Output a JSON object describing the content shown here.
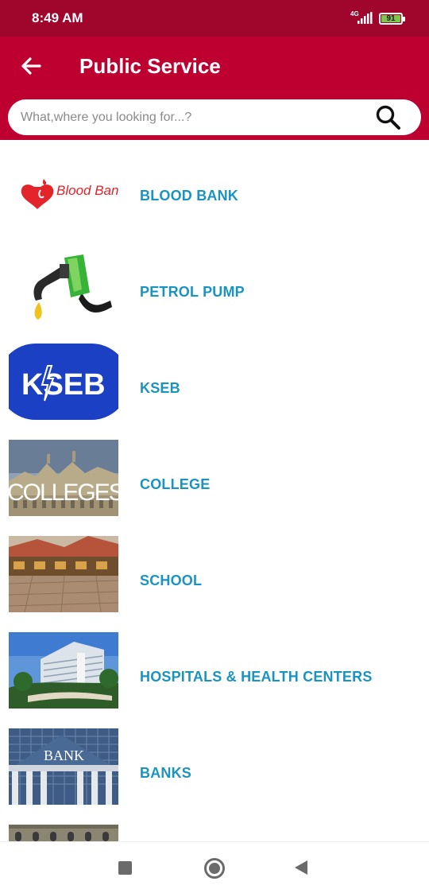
{
  "status_bar": {
    "time": "8:49 AM",
    "network": "4G",
    "battery": "91"
  },
  "app_bar": {
    "back_icon": "arrow-left-icon",
    "title": "Public Service"
  },
  "search": {
    "placeholder": "What,where you looking for...?",
    "value": "",
    "icon": "search-icon"
  },
  "services": [
    {
      "label": "BLOOD BANK",
      "thumb_text": "Blood Bank"
    },
    {
      "label": "PETROL PUMP"
    },
    {
      "label": "KSEB",
      "thumb_text": "KSEB"
    },
    {
      "label": "COLLEGE",
      "thumb_text": "COLLEGES"
    },
    {
      "label": "SCHOOL"
    },
    {
      "label": "HOSPITALS & HEALTH CENTERS"
    },
    {
      "label": "BANKS",
      "thumb_text": "BANK"
    }
  ],
  "colors": {
    "status_bar": "#a0062c",
    "app_bar": "#bd0030",
    "item_label": "#1b93c0",
    "kseb_blue": "#1b40c4"
  },
  "nav_bar": {
    "recents_icon": "square-icon",
    "home_icon": "circle-icon",
    "back_icon": "triangle-back-icon"
  }
}
